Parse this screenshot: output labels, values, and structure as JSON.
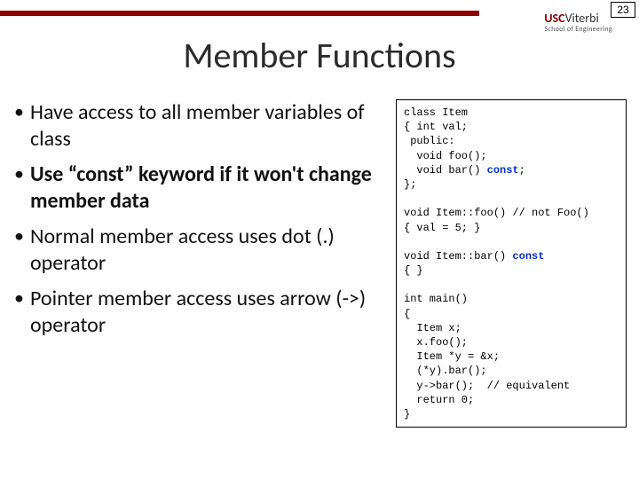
{
  "page_number": "23",
  "logo": {
    "usc": "USC",
    "viterbi": "Viterbi",
    "subline": "School of Engineering"
  },
  "title": "Member Functions",
  "bullets": [
    {
      "text": "Have access to all member variables of class",
      "bold": false
    },
    {
      "text": "Use “const” keyword if it won't change member data",
      "bold": true
    },
    {
      "text": "Normal member access uses dot (.) operator",
      "bold": false
    },
    {
      "text": "Pointer member access uses arrow (->) operator",
      "bold": false
    }
  ],
  "code": {
    "l01": "class Item",
    "l02": "{ int val;",
    "l03": " public:",
    "l04": "  void foo();",
    "l05a": "  void bar() ",
    "l05b": "const",
    "l05c": ";",
    "l06": "};",
    "l07a": "void Item::foo() ",
    "l07b": "// not Foo()",
    "l08": "{ val = 5; }",
    "l09a": "void Item::bar() ",
    "l09b": "const",
    "l10": "{ }",
    "l11": "int main()",
    "l12": "{",
    "l13": "  Item x;",
    "l14": "  x.foo();",
    "l15": "  Item *y = &x;",
    "l16": "  (*y).bar();",
    "l17": "  y->bar();  // equivalent",
    "l18": "  return 0;",
    "l19": "}"
  }
}
